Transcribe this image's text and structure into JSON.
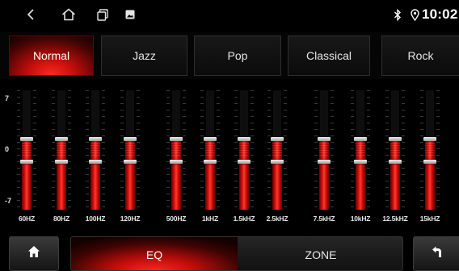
{
  "status_bar": {
    "time": "10:02",
    "icons": [
      "back-icon",
      "home-icon",
      "recent-apps-icon",
      "photo-icon",
      "bluetooth-icon",
      "location-icon"
    ]
  },
  "presets": [
    {
      "label": "Normal",
      "active": true
    },
    {
      "label": "Jazz",
      "active": false
    },
    {
      "label": "Pop",
      "active": false
    },
    {
      "label": "Classical",
      "active": false
    },
    {
      "label": "Rock",
      "active": false
    }
  ],
  "scale": {
    "max": "7",
    "mid": "0",
    "min": "-7"
  },
  "bands": [
    {
      "label": "60HZ",
      "gain": 0
    },
    {
      "label": "80HZ",
      "gain": 0
    },
    {
      "label": "100HZ",
      "gain": 0
    },
    {
      "label": "120HZ",
      "gain": 0
    },
    {
      "label": "500HZ",
      "gain": 0
    },
    {
      "label": "1kHZ",
      "gain": 0
    },
    {
      "label": "1.5kHZ",
      "gain": 0
    },
    {
      "label": "2.5kHZ",
      "gain": 0
    },
    {
      "label": "7.5kHZ",
      "gain": 0
    },
    {
      "label": "10kHZ",
      "gain": 0
    },
    {
      "label": "12.5kHZ",
      "gain": 0
    },
    {
      "label": "15kHZ",
      "gain": 0
    }
  ],
  "bottom": {
    "eq_label": "EQ",
    "zone_label": "ZONE",
    "active": "EQ"
  },
  "colors": {
    "accent": "#e0140f",
    "background": "#000000"
  }
}
